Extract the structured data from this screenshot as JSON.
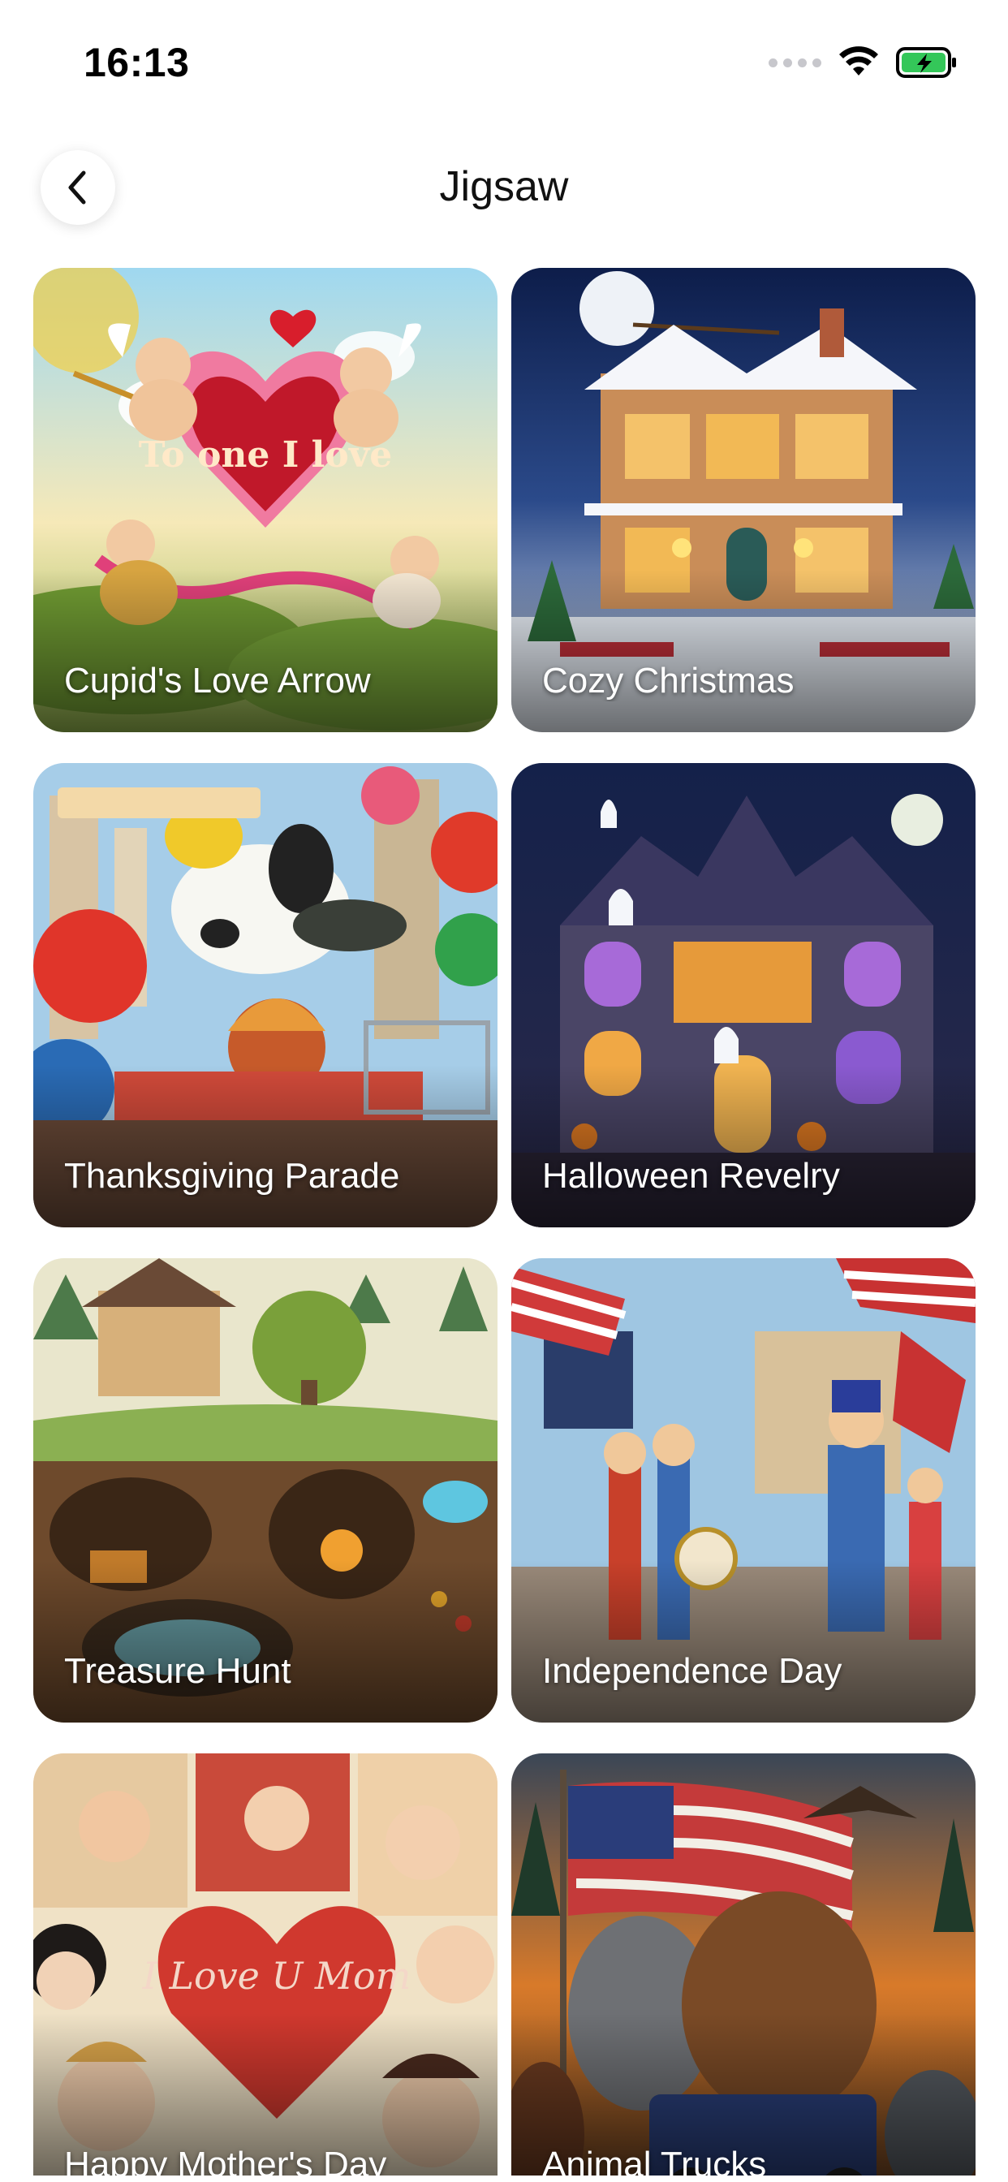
{
  "status_bar": {
    "time": "16:13"
  },
  "header": {
    "title": "Jigsaw"
  },
  "puzzles": [
    {
      "title": "Cupid's Love Arrow",
      "art": "cupid",
      "art_text": "To one I love"
    },
    {
      "title": "Cozy Christmas",
      "art": "christmas"
    },
    {
      "title": "Thanksgiving Parade",
      "art": "parade"
    },
    {
      "title": "Halloween Revelry",
      "art": "halloween"
    },
    {
      "title": "Treasure Hunt",
      "art": "treasure"
    },
    {
      "title": "Independence Day",
      "art": "independence"
    },
    {
      "title": "Happy Mother's Day",
      "art": "mothers",
      "art_text": "I Love U Mom"
    },
    {
      "title": "Animal Trucks",
      "art": "trucks"
    }
  ]
}
